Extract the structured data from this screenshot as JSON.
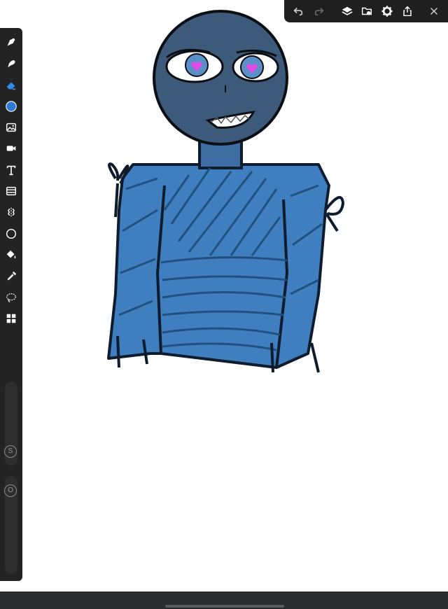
{
  "toolbar": {
    "tools": [
      {
        "name": "brush-tool-icon",
        "active": false
      },
      {
        "name": "smudge-tool-icon",
        "active": false
      },
      {
        "name": "eraser-tool-icon",
        "active": true
      },
      {
        "name": "color-picker-icon",
        "active": false
      },
      {
        "name": "image-import-icon",
        "active": false
      },
      {
        "name": "video-icon",
        "active": false
      },
      {
        "name": "text-tool-icon",
        "active": false
      },
      {
        "name": "frame-tool-icon",
        "active": false
      },
      {
        "name": "symmetry-icon",
        "active": false
      },
      {
        "name": "shape-tool-icon",
        "active": false
      },
      {
        "name": "fill-bucket-icon",
        "active": false
      },
      {
        "name": "eyedropper-icon",
        "active": false
      },
      {
        "name": "lasso-select-icon",
        "active": false
      },
      {
        "name": "apps-icon",
        "active": false
      }
    ],
    "current_color": "#2e78d2",
    "size_slider_label": "S",
    "opacity_slider_label": "O"
  },
  "topbar": {
    "buttons": [
      "undo-icon",
      "redo-icon",
      "layers-icon",
      "gallery-icon",
      "settings-icon",
      "share-icon",
      "close-icon"
    ]
  },
  "colors": {
    "ui_dark": "#232323",
    "active_tool": "#2e8be6",
    "canvas_bg": "#ffffff",
    "drawing_skin": "#3e5a7a",
    "drawing_sweater": "#3f7fc0",
    "drawing_eyes_heart": "#e04be8"
  }
}
